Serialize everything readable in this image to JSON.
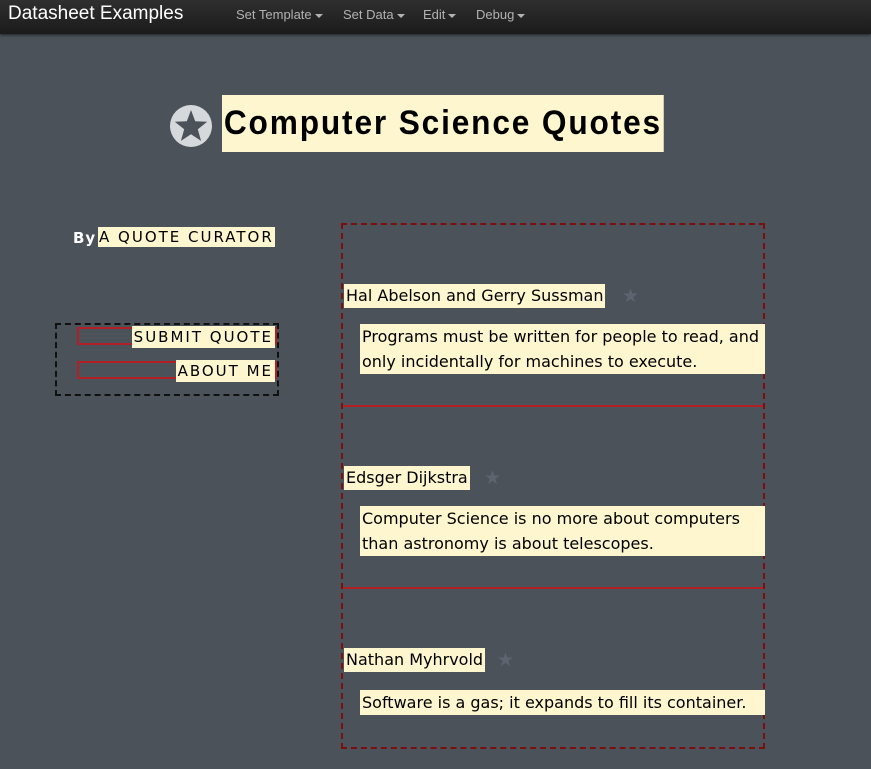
{
  "navbar": {
    "brand": "Datasheet Examples",
    "menus": [
      "Set Template",
      "Set Data",
      "Edit",
      "Debug"
    ]
  },
  "hero": {
    "title": "Computer Science Quotes",
    "icon": "star-icon"
  },
  "byline": {
    "label": "By",
    "curator": "A QUOTE CURATOR"
  },
  "nav": {
    "submit": "SUBMIT QUOTE",
    "about": "ABOUT ME"
  },
  "quotes": [
    {
      "author": "Hal Abelson and Gerry Sussman",
      "text": "Programs must be written for people to read, and only incidentally for machines to execute."
    },
    {
      "author": "Edsger Dijkstra",
      "text": "Computer Science is no more about computers than astronomy is about telescopes."
    },
    {
      "author": "Nathan Myhrvold",
      "text": "Software is a gas; it expands to fill its container."
    }
  ],
  "colors": {
    "background": "#4b525a",
    "highlight": "#fdf6cf",
    "accent_red": "#b21f24"
  }
}
